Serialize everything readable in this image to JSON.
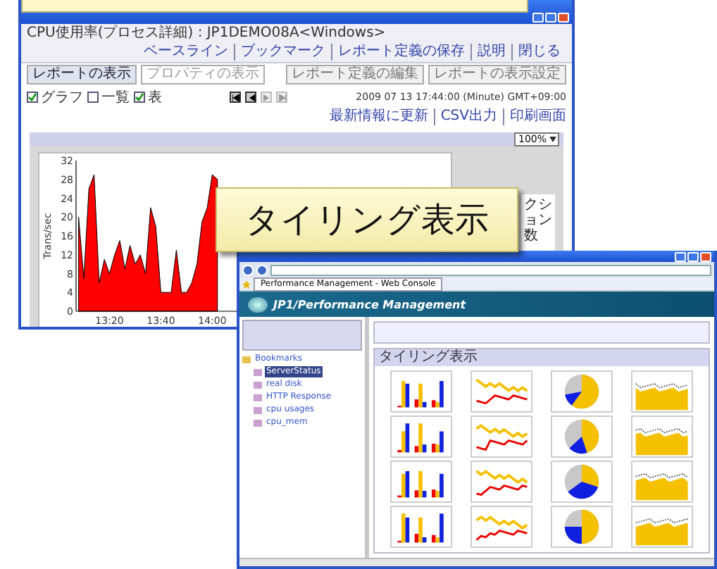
{
  "banner": {
    "visible": true
  },
  "report_window": {
    "title_text": "CPU使用率(プロセス詳細) : JP1DEMO08A<Windows>",
    "header_links": [
      "ベースライン",
      "ブックマーク",
      "レポート定義の保存",
      "説明",
      "閉じる"
    ],
    "tabs": [
      {
        "label": "レポートの表示",
        "selected": true
      },
      {
        "label": "プロパティの表示",
        "selected": false
      }
    ],
    "buttons": [
      "レポート定義の編集",
      "レポートの表示設定"
    ],
    "checkboxes": [
      {
        "label": "グラフ",
        "checked": true
      },
      {
        "label": "一覧",
        "checked": false
      },
      {
        "label": "表",
        "checked": true
      }
    ],
    "nav_buttons": [
      {
        "kind": "first",
        "disabled": false
      },
      {
        "kind": "previous",
        "disabled": false
      },
      {
        "kind": "next",
        "disabled": true
      },
      {
        "kind": "last",
        "disabled": true
      }
    ],
    "timestamp": "2009 07 13 17:44:00 (Minute) GMT+09:00",
    "action_links": [
      "最新情報に更新",
      "CSV出力",
      "印刷画面"
    ],
    "zoom": "100%",
    "chart_data": {
      "type": "area",
      "ylabel": "Trans/sec",
      "ylim": [
        0,
        32
      ],
      "yticks": [
        0,
        4,
        8,
        12,
        16,
        20,
        24,
        28,
        32
      ],
      "categories": [
        null,
        null,
        null,
        null,
        null,
        null,
        "13:20",
        null,
        null,
        null,
        null,
        null,
        null,
        null,
        null,
        null,
        "13:40",
        null,
        null,
        null,
        null,
        null,
        null,
        null,
        null,
        null,
        "14:00",
        null
      ],
      "series": [
        {
          "color": "#ff0000",
          "values": [
            20,
            7,
            26,
            29,
            6,
            11,
            8,
            12,
            15,
            9,
            14,
            10,
            12,
            8,
            22,
            18,
            4,
            4,
            4,
            13,
            4,
            4,
            6,
            10,
            19,
            22,
            29,
            28
          ]
        }
      ]
    },
    "legend_text": "クション数"
  },
  "callout": {
    "text": "タイリング表示"
  },
  "console_window": {
    "tab_title": "Performance Management - Web Console",
    "product": "JP1/Performance Management",
    "tree": [
      {
        "label": "Bookmarks",
        "selected": false,
        "children": [
          {
            "label": "ServerStatus",
            "selected": true
          },
          {
            "label": "real disk",
            "selected": false
          },
          {
            "label": "HTTP Response",
            "selected": false
          },
          {
            "label": "cpu usages",
            "selected": false
          },
          {
            "label": "cpu_mem",
            "selected": false
          }
        ]
      }
    ],
    "panel_title": "タイリング表示",
    "tiles": [
      {
        "kind": "bar"
      },
      {
        "kind": "line"
      },
      {
        "kind": "pie"
      },
      {
        "kind": "area"
      },
      {
        "kind": "bar"
      },
      {
        "kind": "line"
      },
      {
        "kind": "pie"
      },
      {
        "kind": "area"
      },
      {
        "kind": "bar"
      },
      {
        "kind": "line"
      },
      {
        "kind": "pie"
      },
      {
        "kind": "area"
      },
      {
        "kind": "bar"
      },
      {
        "kind": "line"
      },
      {
        "kind": "pie"
      },
      {
        "kind": "area"
      }
    ]
  }
}
